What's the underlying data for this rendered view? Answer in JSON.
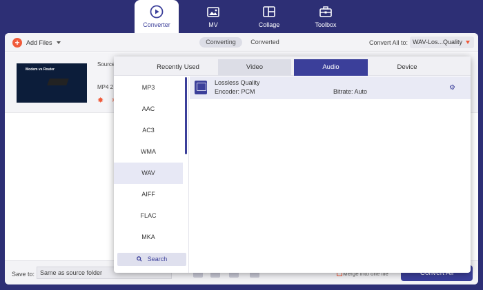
{
  "nav": {
    "items": [
      {
        "label": "Converter",
        "icon": "converter-icon"
      },
      {
        "label": "MV",
        "icon": "mv-icon"
      },
      {
        "label": "Collage",
        "icon": "collage-icon"
      },
      {
        "label": "Toolbox",
        "icon": "toolbox-icon"
      }
    ]
  },
  "toolbar": {
    "add_files": "Add Files",
    "tabs": [
      "Converting",
      "Converted"
    ],
    "convert_all_label": "Convert All to:",
    "convert_all_value": "WAV-Los...Quality"
  },
  "file": {
    "thumb_caption": "Modem vs Router",
    "source_label": "Source",
    "format_label": "MP4  2"
  },
  "popup": {
    "tabs": [
      "Recently Used",
      "Video",
      "Audio",
      "Device"
    ],
    "formats": [
      "MP3",
      "AAC",
      "AC3",
      "WMA",
      "WAV",
      "AIFF",
      "FLAC",
      "MKA"
    ],
    "active_format": "WAV",
    "search_label": "Search",
    "quality": {
      "name": "Lossless Quality",
      "encoder": "Encoder: PCM",
      "bitrate": "Bitrate: Auto"
    }
  },
  "bottom": {
    "save_to_label": "Save to:",
    "save_to_value": "Same as source folder",
    "merge_label": "Merge into one file",
    "convert_all_button": "Convert All"
  },
  "colors": {
    "primary": "#3b3f9a",
    "accent": "#f05a3a",
    "background": "#2d2f75"
  }
}
